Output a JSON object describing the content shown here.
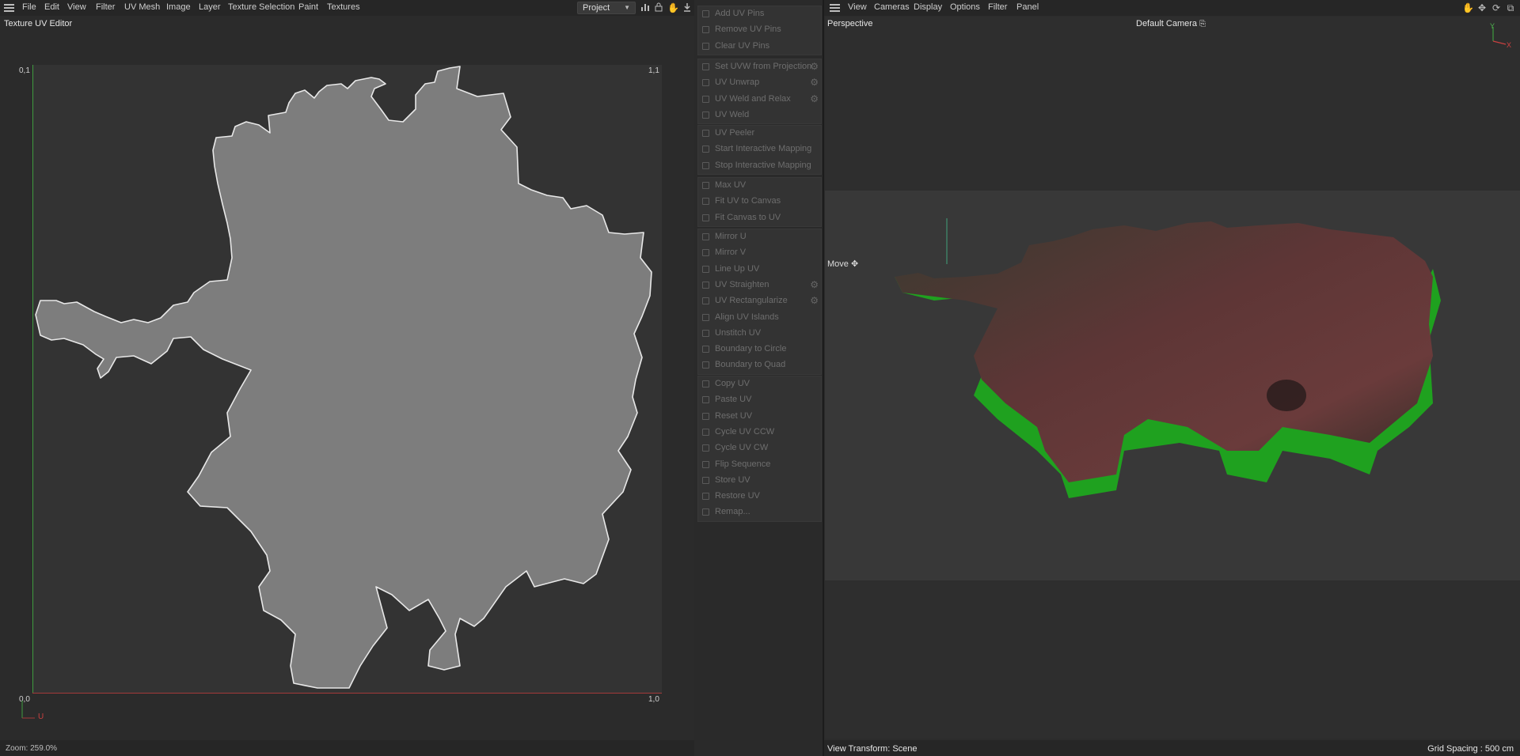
{
  "uv_editor": {
    "menu": [
      "File",
      "Edit",
      "View",
      "Filter",
      "UV Mesh",
      "Image",
      "Layer",
      "Texture Selection",
      "Paint",
      "Textures"
    ],
    "panel_title": "Texture UV Editor",
    "project_select": "Project",
    "corner_labels": {
      "top_left": "0,1",
      "top_right": "1,1",
      "bottom_left": "0,0",
      "bottom_right": "1,0"
    },
    "u_axis_label": "U",
    "zoom": "Zoom: 259.0%",
    "colors": {
      "v_axis": "#3f9b3f",
      "u_axis": "#a33a3a",
      "island_fill": "#7d7d7d",
      "island_stroke": "#e8e8e8"
    }
  },
  "uv_commands": {
    "groups": [
      [
        {
          "label": "Add UV Pins",
          "icon": "pin-add-icon",
          "gear": false
        },
        {
          "label": "Remove UV Pins",
          "icon": "pin-remove-icon",
          "gear": false
        },
        {
          "label": "Clear UV Pins",
          "icon": "pin-clear-icon",
          "gear": false
        }
      ],
      [
        {
          "label": "Set UVW from Projection",
          "icon": "projection-icon",
          "gear": true
        },
        {
          "label": "UV Unwrap",
          "icon": "unwrap-icon",
          "gear": true
        },
        {
          "label": "UV Weld and Relax",
          "icon": "weld-relax-icon",
          "gear": true
        },
        {
          "label": "UV Weld",
          "icon": "weld-icon",
          "gear": false
        }
      ],
      [
        {
          "label": "UV Peeler",
          "icon": "peeler-icon",
          "gear": false
        },
        {
          "label": "Start Interactive Mapping",
          "icon": "play-icon",
          "gear": false
        },
        {
          "label": "Stop Interactive Mapping",
          "icon": "stop-icon",
          "gear": false
        }
      ],
      [
        {
          "label": "Max UV",
          "icon": "max-icon",
          "gear": false
        },
        {
          "label": "Fit UV to Canvas",
          "icon": "fit-uv-icon",
          "gear": false
        },
        {
          "label": "Fit Canvas to UV",
          "icon": "fit-canvas-icon",
          "gear": false
        }
      ],
      [
        {
          "label": "Mirror U",
          "icon": "mirror-u-icon",
          "gear": false
        },
        {
          "label": "Mirror V",
          "icon": "mirror-v-icon",
          "gear": false
        },
        {
          "label": "Line Up UV",
          "icon": "line-up-icon",
          "gear": false
        },
        {
          "label": "UV Straighten",
          "icon": "straighten-icon",
          "gear": true
        },
        {
          "label": "UV Rectangularize",
          "icon": "rectangularize-icon",
          "gear": true
        },
        {
          "label": "Align UV Islands",
          "icon": "align-icon",
          "gear": false
        },
        {
          "label": "Unstitch UV",
          "icon": "unstitch-icon",
          "gear": false
        },
        {
          "label": "Boundary to Circle",
          "icon": "circle-icon",
          "gear": false
        },
        {
          "label": "Boundary to Quad",
          "icon": "quad-icon",
          "gear": false
        }
      ],
      [
        {
          "label": "Copy UV",
          "icon": "copy-icon",
          "gear": false
        },
        {
          "label": "Paste UV",
          "icon": "paste-icon",
          "gear": false
        },
        {
          "label": "Reset UV",
          "icon": "reset-icon",
          "gear": false
        },
        {
          "label": "Cycle UV CCW",
          "icon": "cycle-ccw-icon",
          "gear": false
        },
        {
          "label": "Cycle UV CW",
          "icon": "cycle-cw-icon",
          "gear": false
        },
        {
          "label": "Flip Sequence",
          "icon": "flip-icon",
          "gear": false
        },
        {
          "label": "Store UV",
          "icon": "store-icon",
          "gear": false
        },
        {
          "label": "Restore UV",
          "icon": "restore-icon",
          "gear": false
        },
        {
          "label": "Remap...",
          "icon": "remap-icon",
          "gear": false
        }
      ]
    ]
  },
  "viewport": {
    "menu": [
      "View",
      "Cameras",
      "Display",
      "Options",
      "Filter",
      "Panel"
    ],
    "view_name": "Perspective",
    "camera": "Default Camera",
    "tool": "Move",
    "view_transform": "View Transform: Scene",
    "grid_spacing": "Grid Spacing : 500 cm",
    "axis_labels": {
      "y": "Y",
      "x": "X"
    },
    "colors": {
      "extrusion_side": "#1fa11f",
      "terrain_top": "#5a3434",
      "background_band": "#383838"
    }
  }
}
